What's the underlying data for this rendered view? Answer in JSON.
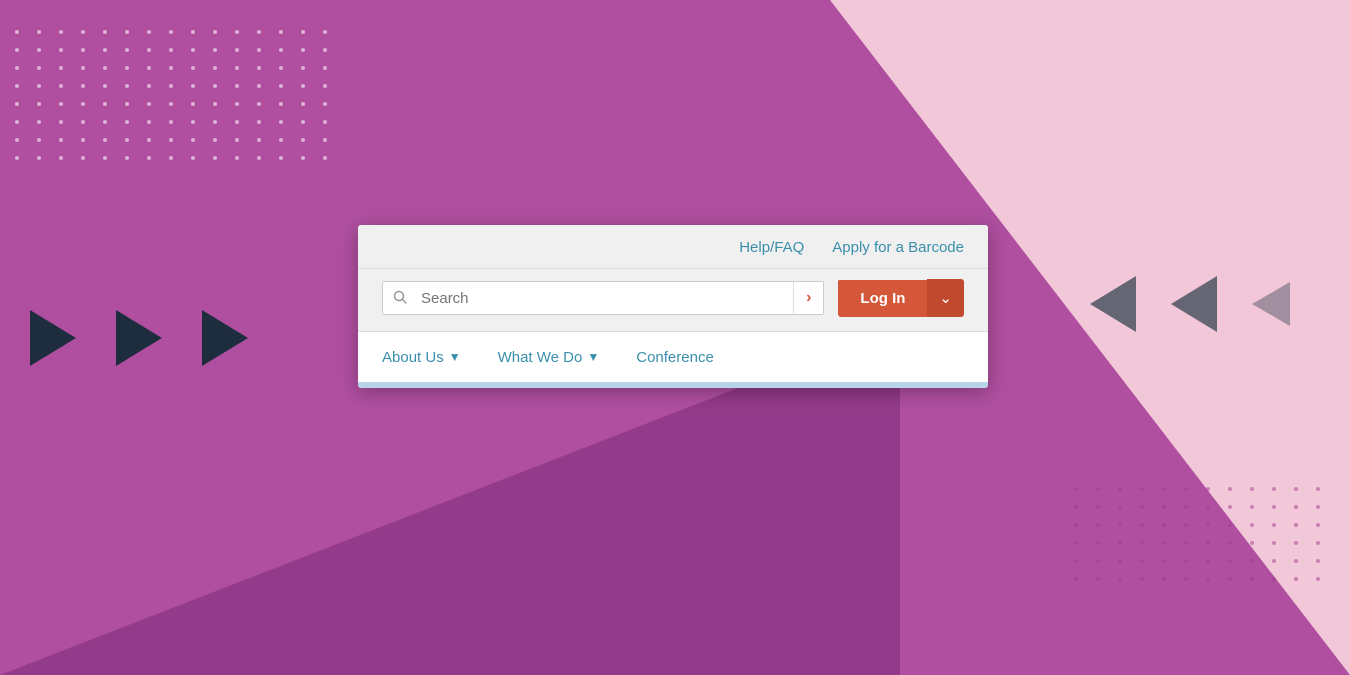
{
  "background": {
    "main_color": "#b04fa0",
    "pink_color": "#f2c8d8",
    "purple_color": "#943a8a"
  },
  "utility_bar": {
    "help_faq_label": "Help/FAQ",
    "apply_barcode_label": "Apply for a Barcode"
  },
  "search": {
    "placeholder": "Search",
    "submit_icon": "›"
  },
  "login": {
    "label": "Log In",
    "dropdown_icon": "⌄"
  },
  "nav": {
    "items": [
      {
        "label": "About Us",
        "has_dropdown": true
      },
      {
        "label": "What We Do",
        "has_dropdown": true
      },
      {
        "label": "Conference",
        "has_dropdown": false
      }
    ]
  }
}
